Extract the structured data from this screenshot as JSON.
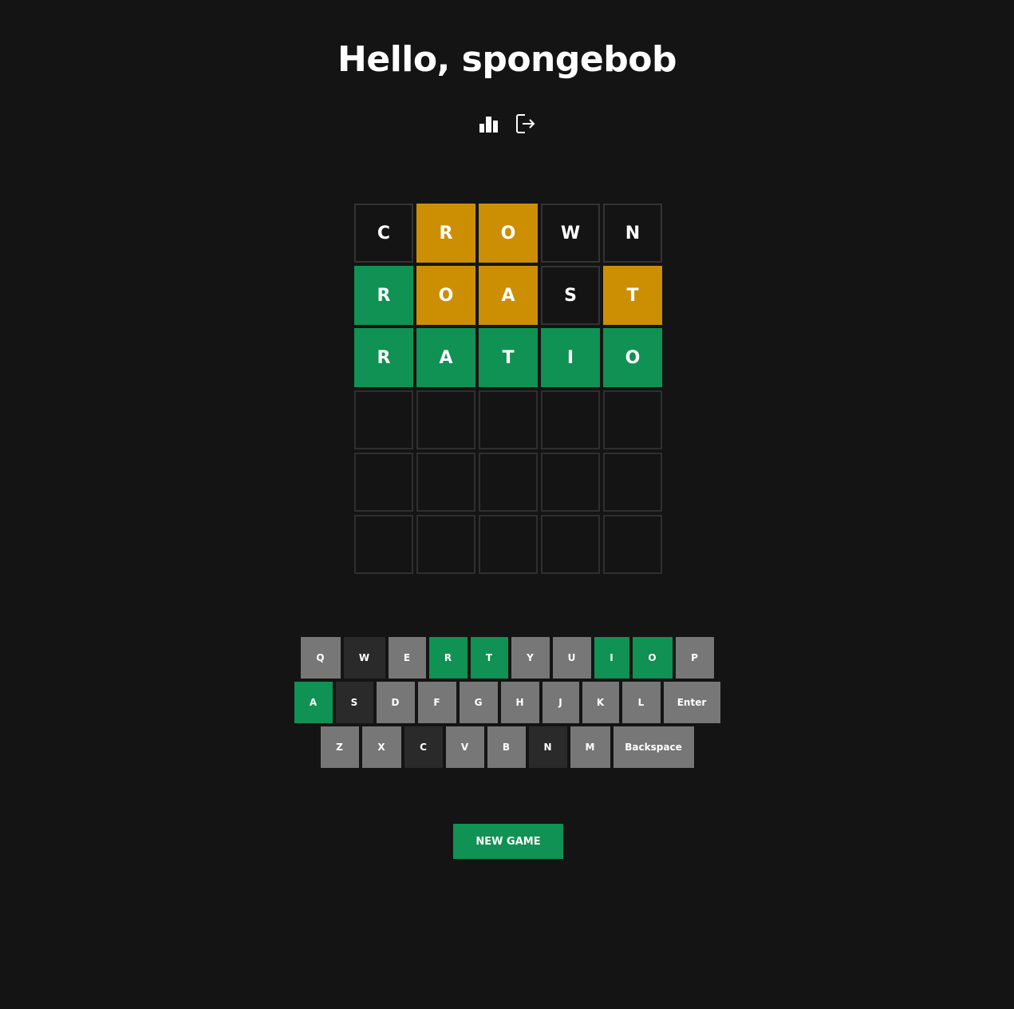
{
  "header": {
    "title": "Hello, spongebob",
    "icons": [
      "stats-icon",
      "logout-icon"
    ]
  },
  "colors": {
    "background": "#141414",
    "correct": "#0f9253",
    "present": "#cc8f04",
    "absent_tile": "#141414",
    "absent_key": "#2a2a2a",
    "unused_key": "#777777",
    "empty_border": "#2f2f2f"
  },
  "board": {
    "rows": [
      [
        {
          "letter": "C",
          "state": "absent"
        },
        {
          "letter": "R",
          "state": "present"
        },
        {
          "letter": "O",
          "state": "present"
        },
        {
          "letter": "W",
          "state": "absent"
        },
        {
          "letter": "N",
          "state": "absent"
        }
      ],
      [
        {
          "letter": "R",
          "state": "correct"
        },
        {
          "letter": "O",
          "state": "present"
        },
        {
          "letter": "A",
          "state": "present"
        },
        {
          "letter": "S",
          "state": "absent"
        },
        {
          "letter": "T",
          "state": "present"
        }
      ],
      [
        {
          "letter": "R",
          "state": "correct"
        },
        {
          "letter": "A",
          "state": "correct"
        },
        {
          "letter": "T",
          "state": "correct"
        },
        {
          "letter": "I",
          "state": "correct"
        },
        {
          "letter": "O",
          "state": "correct"
        }
      ],
      [
        {
          "letter": "",
          "state": "empty"
        },
        {
          "letter": "",
          "state": "empty"
        },
        {
          "letter": "",
          "state": "empty"
        },
        {
          "letter": "",
          "state": "empty"
        },
        {
          "letter": "",
          "state": "empty"
        }
      ],
      [
        {
          "letter": "",
          "state": "empty"
        },
        {
          "letter": "",
          "state": "empty"
        },
        {
          "letter": "",
          "state": "empty"
        },
        {
          "letter": "",
          "state": "empty"
        },
        {
          "letter": "",
          "state": "empty"
        }
      ],
      [
        {
          "letter": "",
          "state": "empty"
        },
        {
          "letter": "",
          "state": "empty"
        },
        {
          "letter": "",
          "state": "empty"
        },
        {
          "letter": "",
          "state": "empty"
        },
        {
          "letter": "",
          "state": "empty"
        }
      ]
    ]
  },
  "keyboard": {
    "rows": [
      [
        {
          "label": "Q",
          "state": "unused"
        },
        {
          "label": "W",
          "state": "absent"
        },
        {
          "label": "E",
          "state": "unused"
        },
        {
          "label": "R",
          "state": "correct"
        },
        {
          "label": "T",
          "state": "correct"
        },
        {
          "label": "Y",
          "state": "unused"
        },
        {
          "label": "U",
          "state": "unused"
        },
        {
          "label": "I",
          "state": "correct"
        },
        {
          "label": "O",
          "state": "correct"
        },
        {
          "label": "P",
          "state": "unused"
        }
      ],
      [
        {
          "label": "A",
          "state": "correct"
        },
        {
          "label": "S",
          "state": "absent"
        },
        {
          "label": "D",
          "state": "unused"
        },
        {
          "label": "F",
          "state": "unused"
        },
        {
          "label": "G",
          "state": "unused"
        },
        {
          "label": "H",
          "state": "unused"
        },
        {
          "label": "J",
          "state": "unused"
        },
        {
          "label": "K",
          "state": "unused"
        },
        {
          "label": "L",
          "state": "unused"
        },
        {
          "label": "Enter",
          "state": "unused"
        }
      ],
      [
        {
          "label": "Z",
          "state": "unused"
        },
        {
          "label": "X",
          "state": "unused"
        },
        {
          "label": "C",
          "state": "absent"
        },
        {
          "label": "V",
          "state": "unused"
        },
        {
          "label": "B",
          "state": "unused"
        },
        {
          "label": "N",
          "state": "absent"
        },
        {
          "label": "M",
          "state": "unused"
        },
        {
          "label": "Backspace",
          "state": "unused"
        }
      ]
    ]
  },
  "actions": {
    "new_game_label": "NEW GAME"
  }
}
